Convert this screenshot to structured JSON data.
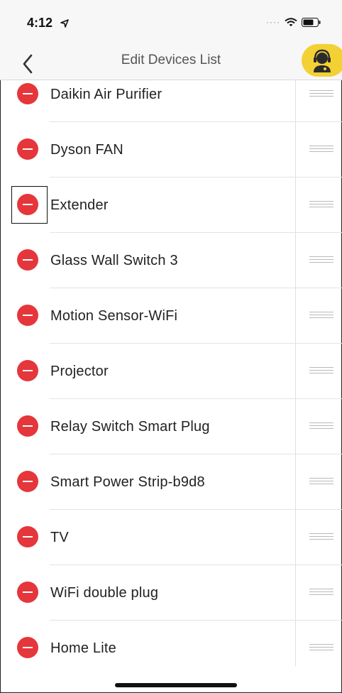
{
  "status_bar": {
    "time": "4:12",
    "icons": [
      "location-arrow-icon",
      "cellular-dots-icon",
      "wifi-icon",
      "battery-icon"
    ]
  },
  "nav": {
    "title": "Edit Devices List",
    "back_icon": "chevron-left-icon",
    "support_icon": "customer-support-icon",
    "accent_color": "#f3d135"
  },
  "devices": [
    {
      "name": "Daikin Air Purifier"
    },
    {
      "name": "Dyson FAN"
    },
    {
      "name": "Extender"
    },
    {
      "name": "Glass Wall Switch 3"
    },
    {
      "name": "Motion Sensor-WiFi"
    },
    {
      "name": "Projector"
    },
    {
      "name": "Relay Switch Smart Plug"
    },
    {
      "name": "Smart Power Strip-b9d8"
    },
    {
      "name": "TV"
    },
    {
      "name": "WiFi double plug"
    },
    {
      "name": "Home Lite"
    }
  ],
  "colors": {
    "delete": "#e5363b",
    "separator": "#e3e3e3"
  }
}
